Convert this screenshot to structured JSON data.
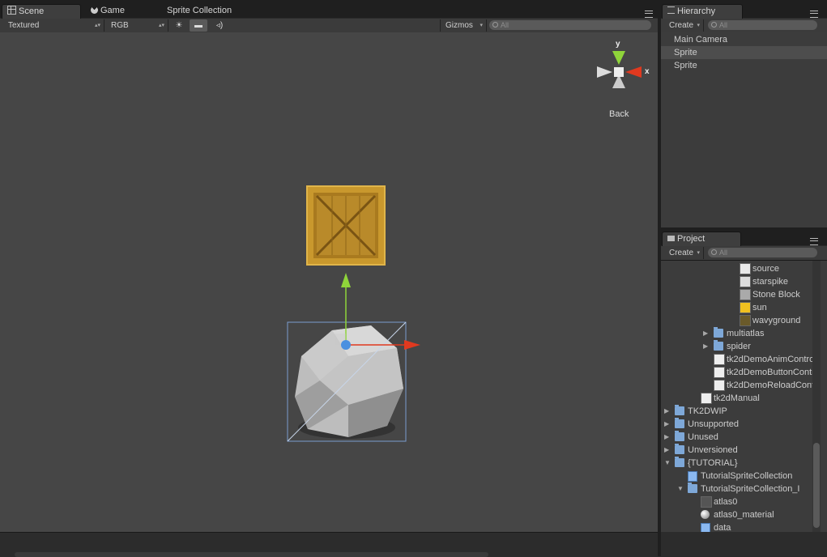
{
  "scene_tabs": {
    "scene": "Scene",
    "game": "Game",
    "sprite_collection": "Sprite Collection"
  },
  "scene_toolbar": {
    "draw_mode": "Textured",
    "render_mode": "RGB",
    "gizmos": "Gizmos",
    "search_placeholder": "All"
  },
  "gizmo": {
    "y": "y",
    "x": "x",
    "view_label": "Back"
  },
  "hierarchy": {
    "title": "Hierarchy",
    "create": "Create",
    "search_placeholder": "All",
    "items": [
      {
        "label": "Main Camera",
        "selected": false
      },
      {
        "label": "Sprite",
        "selected": true
      },
      {
        "label": "Sprite",
        "selected": false
      }
    ]
  },
  "project": {
    "title": "Project",
    "create": "Create",
    "search_placeholder": "All",
    "items": [
      {
        "label": "source",
        "icon": "text-file-icon",
        "expanded": null
      },
      {
        "label": "starspike",
        "icon": "star-texture-icon",
        "expanded": null
      },
      {
        "label": "Stone Block",
        "icon": "stone-texture-icon",
        "expanded": null
      },
      {
        "label": "sun",
        "icon": "sun-texture-icon",
        "expanded": null
      },
      {
        "label": "wavyground",
        "icon": "ground-texture-icon",
        "expanded": null
      },
      {
        "label": "multiatlas",
        "icon": "folder-icon",
        "expanded": false
      },
      {
        "label": "spider",
        "icon": "folder-icon",
        "expanded": false
      },
      {
        "label": "tk2dDemoAnimContro",
        "icon": "script-icon",
        "expanded": null
      },
      {
        "label": "tk2dDemoButtonContr",
        "icon": "script-icon",
        "expanded": null
      },
      {
        "label": "tk2dDemoReloadContr",
        "icon": "script-icon",
        "expanded": null
      },
      {
        "label": "tk2dManual",
        "icon": "document-icon",
        "expanded": null
      },
      {
        "label": "TK2DWIP",
        "icon": "folder-icon",
        "expanded": false
      },
      {
        "label": "Unsupported",
        "icon": "folder-icon",
        "expanded": false
      },
      {
        "label": "Unused",
        "icon": "folder-icon",
        "expanded": false
      },
      {
        "label": "Unversioned",
        "icon": "folder-icon",
        "expanded": false
      },
      {
        "label": "{TUTORIAL}",
        "icon": "folder-open-icon",
        "expanded": true
      },
      {
        "label": "TutorialSpriteCollection",
        "icon": "prefab-icon",
        "expanded": null
      },
      {
        "label": "TutorialSpriteCollection_I",
        "icon": "folder-open-icon",
        "expanded": true
      },
      {
        "label": "atlas0",
        "icon": "texture-icon",
        "expanded": null
      },
      {
        "label": "atlas0_material",
        "icon": "material-icon",
        "expanded": null
      },
      {
        "label": "data",
        "icon": "prefab-icon",
        "expanded": null
      }
    ]
  },
  "colors": {
    "x_axis": "#e0391f",
    "y_axis": "#8fd43a",
    "pivot": "#4a90e0",
    "selection_box": "#7a9ccf",
    "scene_bg": "#464646"
  }
}
